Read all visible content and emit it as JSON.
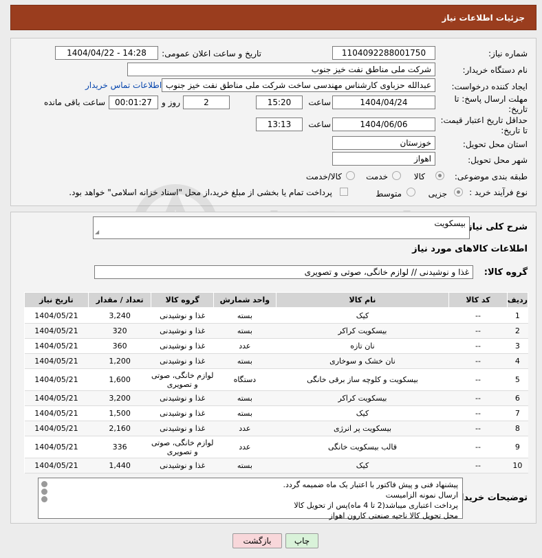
{
  "header": {
    "title": "جزئیات اطلاعات نیاز"
  },
  "fields": {
    "need_number_label": "شماره نیاز:",
    "need_number": "1104092288001750",
    "announce_label": "تاریخ و ساعت اعلان عمومی:",
    "announce_value": "1404/04/22 - 14:28",
    "buyer_label": "نام دستگاه خریدار:",
    "buyer_value": "شرکت ملی مناطق نفت خیز جنوب",
    "creator_label": "ایجاد کننده درخواست:",
    "creator_value": "عبدالله حزباوی کارشناس مهندسی ساخت شرکت ملی مناطق نفت خیز جنوب",
    "contact_link": "اطلاعات تماس خریدار",
    "deadline_label_1": "مهلت ارسال پاسخ: تا",
    "deadline_label_2": "تاریخ:",
    "deadline_date": "1404/04/24",
    "time_label": "ساعت",
    "deadline_time": "15:20",
    "days_value": "2",
    "days_label": "روز و",
    "remaining_value": "00:01:27",
    "remaining_label": "ساعت باقی مانده",
    "validity_label_1": "حداقل تاریخ اعتبار قیمت:",
    "validity_label_2": "تا تاریخ:",
    "validity_date": "1404/06/06",
    "validity_time": "13:13",
    "province_label": "استان محل تحویل:",
    "province_value": "خوزستان",
    "city_label": "شهر محل تحویل:",
    "city_value": "اهواز",
    "category_label": "طبقه بندی موضوعی:",
    "category_options": [
      "کالا",
      "خدمت",
      "کالا/خدمت"
    ],
    "process_label": "نوع فرآیند خرید :",
    "process_options": [
      "جزیی",
      "متوسط"
    ],
    "payment_note": "پرداخت تمام یا بخشی از مبلغ خرید،از محل \"اسناد خزانه اسلامی\" خواهد بود."
  },
  "summary": {
    "label": "شرح کلی نیاز:",
    "value": "بیسکویت",
    "items_title": "اطلاعات کالاهای مورد نیاز",
    "group_label": "گروه کالا:",
    "group_value": "غذا و نوشیدنی // لوازم خانگی، صوتی و تصویری"
  },
  "table": {
    "headers": [
      "ردیف",
      "کد کالا",
      "نام کالا",
      "واحد شمارش",
      "گروه کالا",
      "تعداد / مقدار",
      "تاریخ نیاز"
    ],
    "rows": [
      [
        "1",
        "--",
        "کیک",
        "بسته",
        "غذا و نوشیدنی",
        "3,240",
        "1404/05/21"
      ],
      [
        "2",
        "--",
        "بیسکویت کراکر",
        "بسته",
        "غذا و نوشیدنی",
        "320",
        "1404/05/21"
      ],
      [
        "3",
        "--",
        "نان تازه",
        "عدد",
        "غذا و نوشیدنی",
        "360",
        "1404/05/21"
      ],
      [
        "4",
        "--",
        "نان خشک و سوخاری",
        "بسته",
        "غذا و نوشیدنی",
        "1,200",
        "1404/05/21"
      ],
      [
        "5",
        "--",
        "بیسکویت و کلوچه ساز برقی خانگی",
        "دستگاه",
        "لوازم خانگی، صوتی و تصویری",
        "1,600",
        "1404/05/21"
      ],
      [
        "6",
        "--",
        "بیسکویت کراکر",
        "بسته",
        "غذا و نوشیدنی",
        "3,200",
        "1404/05/21"
      ],
      [
        "7",
        "--",
        "کیک",
        "بسته",
        "غذا و نوشیدنی",
        "1,500",
        "1404/05/21"
      ],
      [
        "8",
        "--",
        "بیسکویت پر انرژی",
        "عدد",
        "غذا و نوشیدنی",
        "2,160",
        "1404/05/21"
      ],
      [
        "9",
        "--",
        "قالب بیسکویت خانگی",
        "عدد",
        "لوازم خانگی، صوتی و تصویری",
        "336",
        "1404/05/21"
      ],
      [
        "10",
        "--",
        "کیک",
        "بسته",
        "غذا و نوشیدنی",
        "1,440",
        "1404/05/21"
      ]
    ]
  },
  "buyer_notes": {
    "label": "توضیحات خریدار:",
    "lines": [
      "پیشنهاد فنی و پیش فاکتور با اعتبار یک ماه ضمیمه گردد.",
      "ارسال نمونه الزامیست",
      "پرداخت اعتباری میباشد(2 تا 4 ماه)پس از تحویل کالا",
      "محل تحویل کالا ناحیه صنعتی کارون اهواز"
    ]
  },
  "buttons": {
    "print": "چاپ",
    "back": "بازگشت"
  },
  "watermark_text": "AriaTender.net",
  "colors": {
    "header": "#9a3d1e",
    "link": "#0645ad",
    "back_button": "#f8d7da",
    "print_button": "#d9f2d9"
  }
}
